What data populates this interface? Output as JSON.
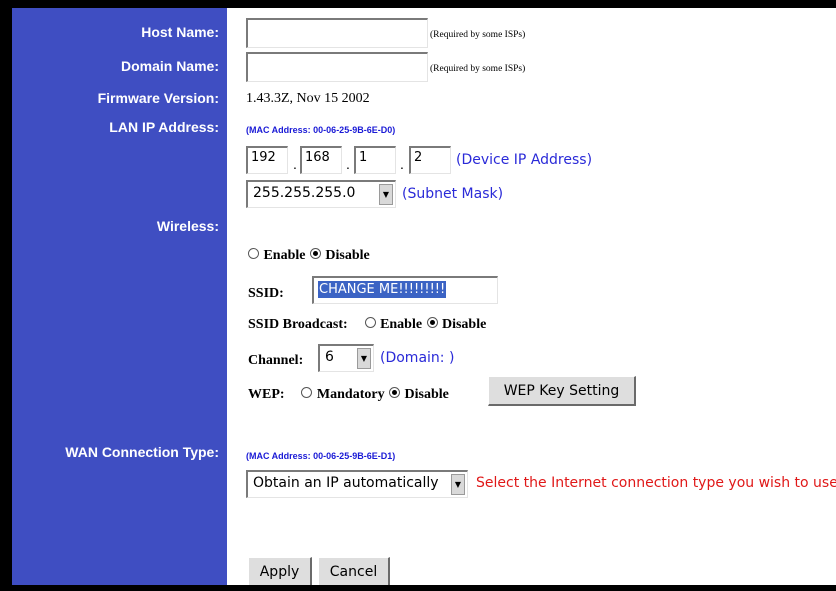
{
  "labels": {
    "host_name": "Host Name:",
    "domain_name": "Domain Name:",
    "firmware_version": "Firmware Version:",
    "lan_ip_address": "LAN IP Address:",
    "wireless": "Wireless:",
    "wan_connection_type": "WAN Connection Type:"
  },
  "host_name": {
    "value": "",
    "note": "(Required by some ISPs)"
  },
  "domain_name": {
    "value": "",
    "note": "(Required by some ISPs)"
  },
  "firmware_version": "1.43.3Z, Nov 15 2002",
  "lan": {
    "mac": "(MAC Address: 00-06-25-9B-6E-D0)",
    "ip_octets": [
      "192",
      "168",
      "1",
      "2"
    ],
    "ip_dot": ".",
    "ip_note": "(Device IP Address)",
    "subnet_mask": "255.255.255.0",
    "subnet_note": "(Subnet Mask)"
  },
  "wireless": {
    "enable_label": "Enable",
    "disable_label": "Disable",
    "selected": "Disable",
    "ssid_label": "SSID:",
    "ssid_value": "CHANGE ME!!!!!!!!!",
    "ssid_broadcast_label": "SSID Broadcast:",
    "broadcast_enable": "Enable",
    "broadcast_disable": "Disable",
    "broadcast_selected": "Disable",
    "channel_label": "Channel:",
    "channel_value": "6",
    "domain_note": "(Domain: )",
    "wep_label": "WEP:",
    "wep_mandatory": "Mandatory",
    "wep_disable": "Disable",
    "wep_selected": "Disable",
    "wep_key_button": "WEP Key Setting"
  },
  "wan": {
    "mac": "(MAC Address: 00-06-25-9B-6E-D1)",
    "connection_type": "Obtain an IP automatically",
    "hint": "Select the Internet connection type you wish to use"
  },
  "buttons": {
    "apply": "Apply",
    "cancel": "Cancel"
  },
  "colors": {
    "sidebar": "#3f4ec2",
    "mac_text": "#1a1ad6",
    "note_blue": "#2a2ad8",
    "hint_red": "#e01818"
  }
}
